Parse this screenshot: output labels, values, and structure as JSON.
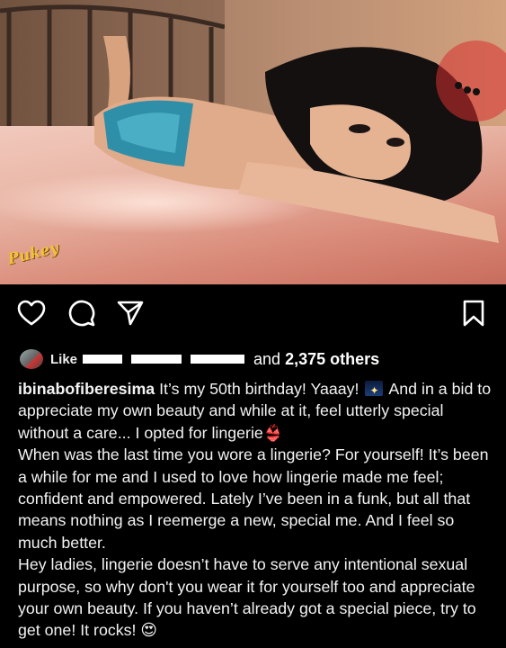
{
  "post": {
    "watermark": "Pukey",
    "liked_by_label": "Like",
    "others_prefix": "and ",
    "others_count": "2,375 others",
    "caption": {
      "username": "ibinabofiberesima",
      "line1_text": " It’s my 50th birthday! Yaaay! ",
      "line1_rest": " And in a bid to appreciate my own beauty and while at it, feel utterly special without a care... I opted for lingerie",
      "para2": "When was the last time you wore a lingerie? For yourself! It’s been a while for me and I used to love how lingerie made me feel; confident and empowered. Lately I’ve been in a funk, but all that means nothing as I reemerge a new, special me. And I feel so much better.",
      "para3": "Hey ladies, lingerie doesn’t have to serve any intentional sexual purpose, so why don't you wear it for yourself too and appreciate your own beauty. If you haven’t already got a special piece, try to get one! It rocks! ",
      "emoji_lingerie": "👙",
      "emoji_heart_eyes": "😍"
    }
  },
  "icons": {
    "like": "heart-icon",
    "comment": "comment-icon",
    "share": "send-icon",
    "save": "bookmark-icon"
  }
}
